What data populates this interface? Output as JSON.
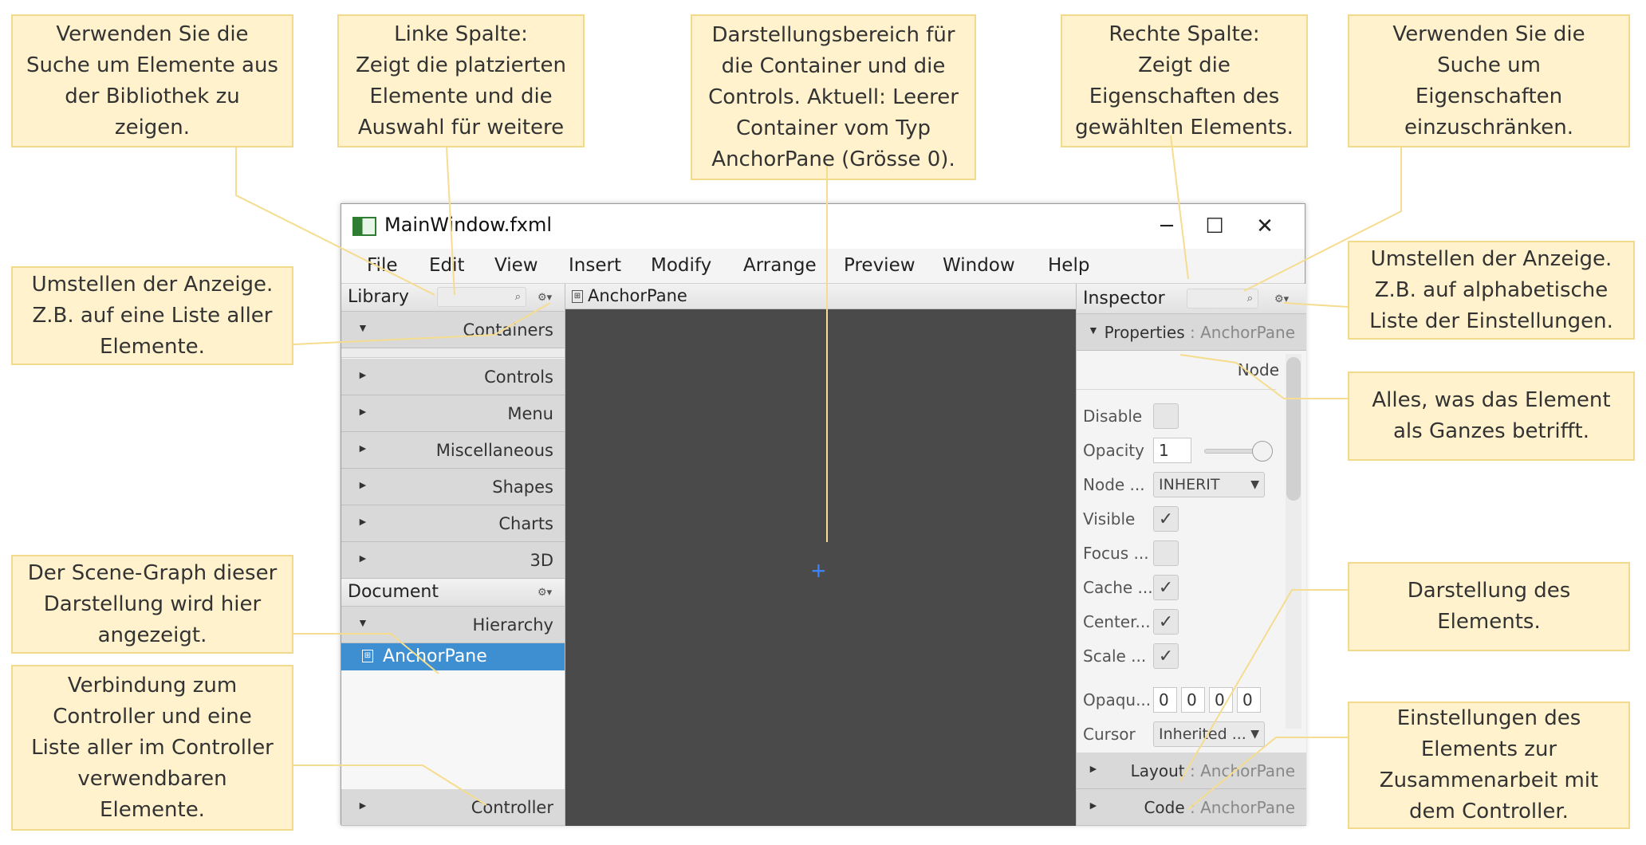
{
  "window": {
    "title": "MainWindow.fxml",
    "minimize": "─",
    "maximize": "☐",
    "close": "✕"
  },
  "menu": [
    "File",
    "Edit",
    "View",
    "Insert",
    "Modify",
    "Arrange",
    "Preview",
    "Window",
    "Help"
  ],
  "library": {
    "header": "Library",
    "search_icon": "search-icon",
    "gear_glyph": "⚙▾",
    "sections": [
      {
        "label": "Containers",
        "expanded": true
      },
      {
        "label": "Controls",
        "expanded": false
      },
      {
        "label": "Menu",
        "expanded": false
      },
      {
        "label": "Miscellaneous",
        "expanded": false
      },
      {
        "label": "Shapes",
        "expanded": false
      },
      {
        "label": "Charts",
        "expanded": false
      },
      {
        "label": "3D",
        "expanded": false
      }
    ]
  },
  "document": {
    "header": "Document",
    "gear_glyph": "⚙▾",
    "hierarchy_label": "Hierarchy",
    "tree_item": "AnchorPane",
    "controller_label": "Controller"
  },
  "center": {
    "breadcrumb": "AnchorPane",
    "crosshair": "+"
  },
  "inspector": {
    "header": "Inspector",
    "gear_glyph": "⚙▾",
    "properties_label": "Properties",
    "properties_sub": " : AnchorPane",
    "node_label": "Node",
    "rows": {
      "disable": "Disable",
      "opacity": "Opacity",
      "opacity_value": "1",
      "node_orientation": "Node ...",
      "node_orientation_value": "INHERIT",
      "visible": "Visible",
      "focus": "Focus ...",
      "cache": "Cache ...",
      "center": "Center...",
      "scale": "Scale ...",
      "opaque": "Opaqu...",
      "opaque_values": [
        "0",
        "0",
        "0",
        "0"
      ],
      "cursor": "Cursor",
      "cursor_value": "Inherited ..."
    },
    "checkmark": "✓",
    "layout_label": "Layout",
    "layout_sub": " : AnchorPane",
    "code_label": "Code",
    "code_sub": " : AnchorPane"
  },
  "callouts": {
    "search_library": "Verwenden Sie die\nSuche um Elemente aus\nder Bibliothek zu\nzeigen.",
    "left_column": "Linke Spalte:\nZeigt die platzierten\nElemente und die\nAuswahl für weitere",
    "display_area": "Darstellungsbereich für\ndie Container und die\nControls. Aktuell: Leerer\nContainer vom Typ\nAnchorPane (Grösse 0).",
    "right_column": "Rechte Spalte:\nZeigt die\nEigenschaften des\ngewählten Elements.",
    "search_props": "Verwenden Sie die\nSuche um\nEigenschaften\neinzuschränken.",
    "toggle_list": "Umstellen der Anzeige.\nZ.B. auf eine Liste aller\nElemente.",
    "toggle_alpha": "Umstellen der Anzeige.\nZ.B. auf alphabetische\nListe der Einstellungen.",
    "whole_element": "Alles, was das Element\nals Ganzes betrifft.",
    "scene_graph": "Der Scene-Graph dieser\nDarstellung wird hier\nangezeigt.",
    "element_display": "Darstellung des\nElements.",
    "controller_link": "Verbindung zum\nController und eine\nListe aller im Controller\nverwendbaren\nElemente.",
    "controller_settings": "Einstellungen des\nElements zur\nZusammenarbeit mit\ndem Controller."
  },
  "colors": {
    "callout_fill": "#fff2cc",
    "callout_border": "#f2d98c",
    "selection": "#3d8fd1",
    "canvas": "#4a4a4a",
    "crosshair": "#3b82f6"
  }
}
